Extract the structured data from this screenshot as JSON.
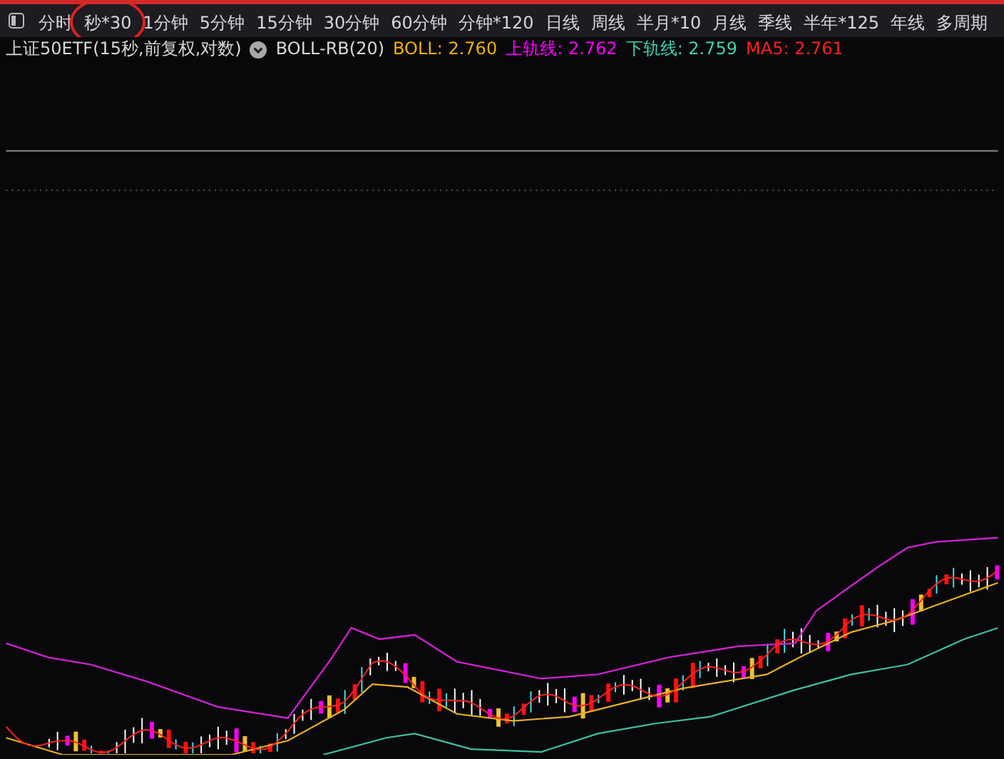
{
  "toolbar": {
    "items": [
      {
        "label": "分时",
        "circled": false
      },
      {
        "label": "秒*30",
        "circled": true
      },
      {
        "label": "1分钟",
        "circled": false
      },
      {
        "label": "5分钟",
        "circled": false
      },
      {
        "label": "15分钟",
        "circled": false
      },
      {
        "label": "30分钟",
        "circled": false
      },
      {
        "label": "60分钟",
        "circled": false
      },
      {
        "label": "分钟*120",
        "circled": false
      },
      {
        "label": "日线",
        "circled": false
      },
      {
        "label": "周线",
        "circled": false
      },
      {
        "label": "半月*10",
        "circled": false
      },
      {
        "label": "月线",
        "circled": false
      },
      {
        "label": "季线",
        "circled": false
      },
      {
        "label": "半年*125",
        "circled": false
      },
      {
        "label": "年线",
        "circled": false
      },
      {
        "label": "多周期",
        "circled": false
      }
    ]
  },
  "legend": {
    "title": "上证50ETF(15秒,前复权,对数)",
    "indicator": "BOLL-RB(20)",
    "values": [
      {
        "text": "BOLL: 2.760",
        "color": "#f0b000"
      },
      {
        "text": "上轨线: 2.762",
        "color": "#ff00ff"
      },
      {
        "text": "下轨线: 2.759",
        "color": "#40d0b0"
      },
      {
        "text": "MA5: 2.761",
        "color": "#ff2020"
      }
    ]
  }
}
